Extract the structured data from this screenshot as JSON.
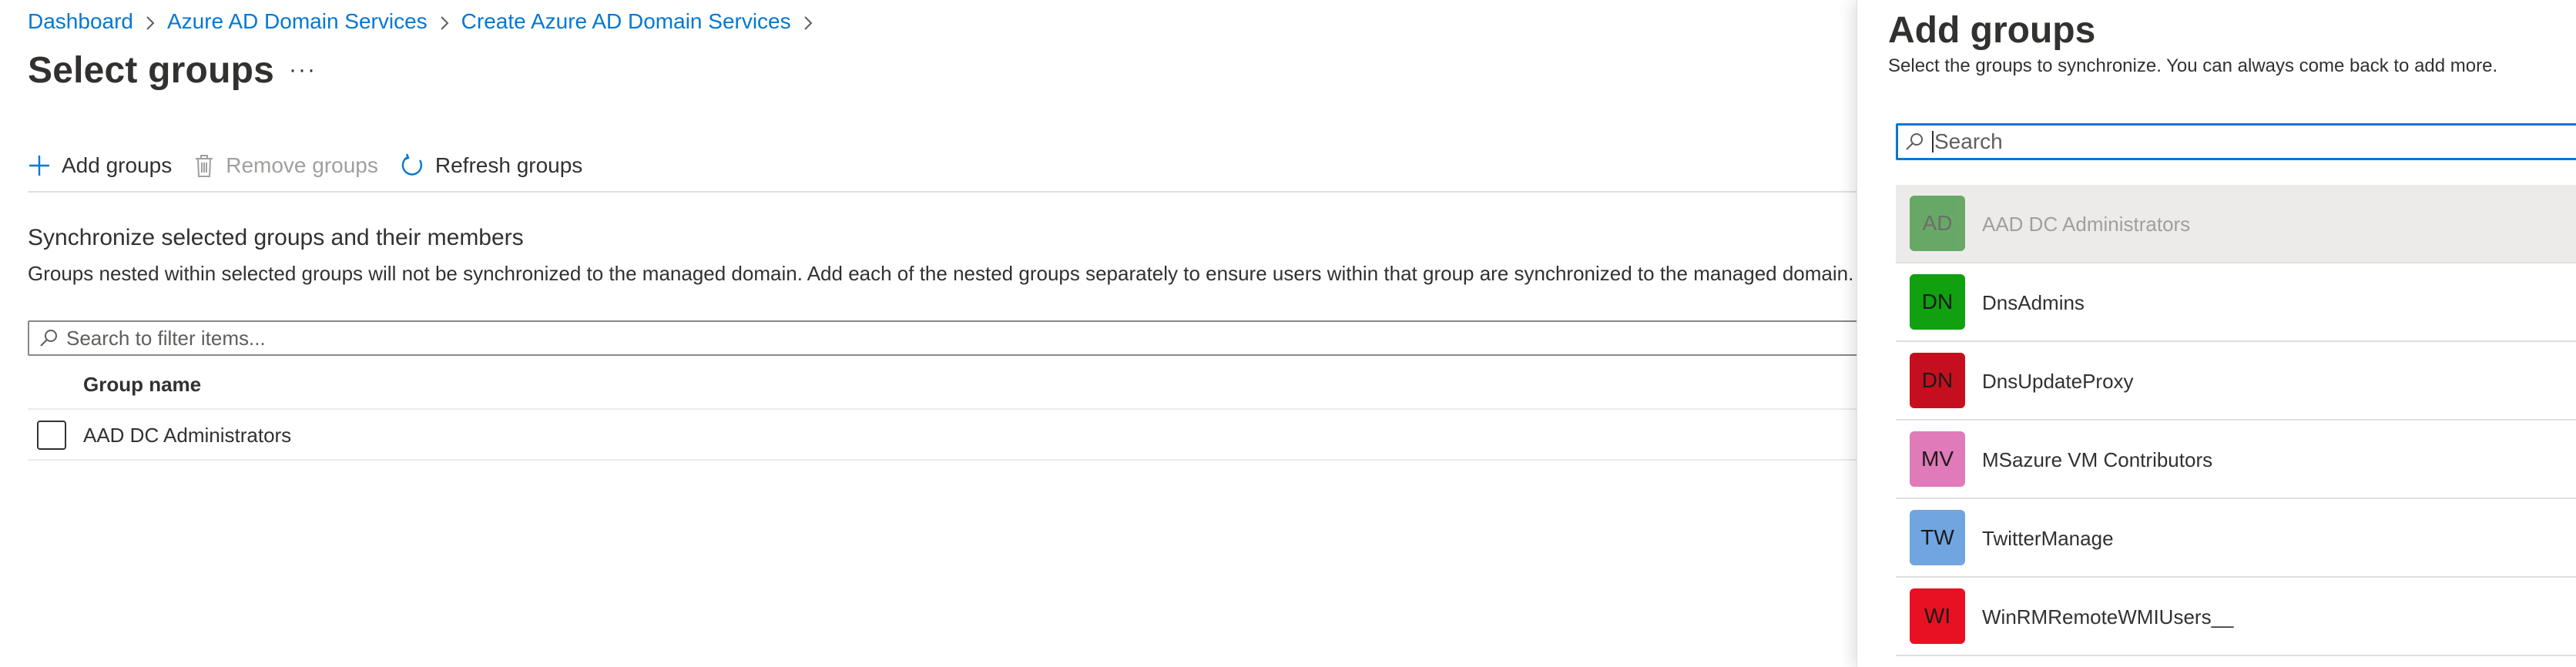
{
  "breadcrumb": {
    "items": [
      "Dashboard",
      "Azure AD Domain Services",
      "Create Azure AD Domain Services"
    ]
  },
  "page": {
    "title": "Select groups",
    "more": "···"
  },
  "toolbar": {
    "add_label": "Add groups",
    "remove_label": "Remove groups",
    "refresh_label": "Refresh groups"
  },
  "section": {
    "title": "Synchronize selected groups and their members",
    "description": "Groups nested within selected groups will not be synchronized to the managed domain. Add each of the nested groups separately to ensure users within that group are synchronized to the managed domain."
  },
  "filter": {
    "placeholder": "Search to filter items..."
  },
  "table": {
    "columns": [
      "Group name"
    ],
    "rows": [
      {
        "name": "AAD DC Administrators",
        "checked": false
      }
    ]
  },
  "panel": {
    "title": "Add groups",
    "subtitle": "Select the groups to synchronize. You can always come back to add more.",
    "search_placeholder": "Search",
    "groups": [
      {
        "initials": "AD",
        "name": "AAD DC Administrators",
        "color": "#107c10",
        "selected": true
      },
      {
        "initials": "DN",
        "name": "DnsAdmins",
        "color": "#10a010",
        "selected": false
      },
      {
        "initials": "DN",
        "name": "DnsUpdateProxy",
        "color": "#c50f1f",
        "selected": false
      },
      {
        "initials": "MV",
        "name": "MSazure VM Contributors",
        "color": "#e07ab8",
        "selected": false
      },
      {
        "initials": "TW",
        "name": "TwitterManage",
        "color": "#71a5e0",
        "selected": false
      },
      {
        "initials": "WI",
        "name": "WinRMRemoteWMIUsers__",
        "color": "#e81123",
        "selected": false
      }
    ]
  },
  "colors": {
    "link": "#0078d4",
    "focus_border": "#0078d4",
    "disabled_text": "#a19f9d"
  }
}
